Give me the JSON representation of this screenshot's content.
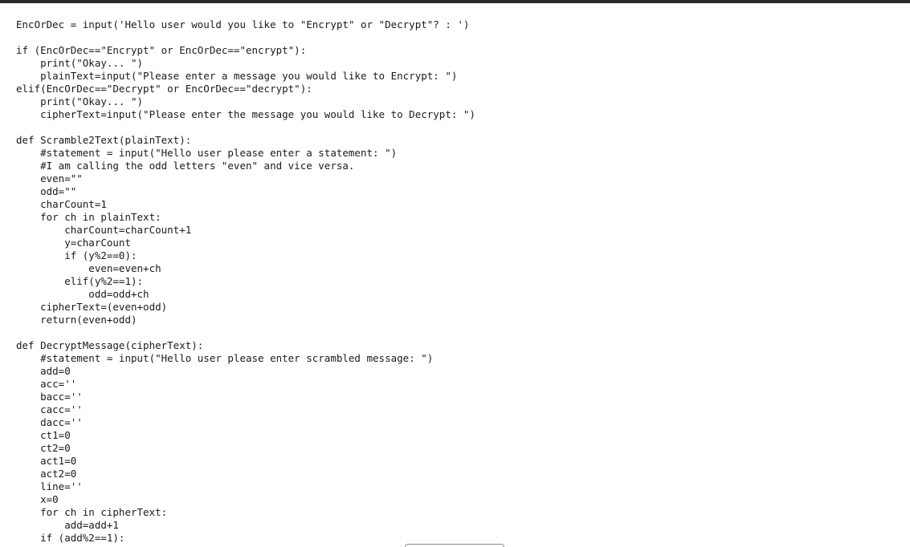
{
  "code": {
    "lines": [
      "EncOrDec = input('Hello user would you like to \"Encrypt\" or \"Decrypt\"? : ')",
      "",
      "if (EncOrDec==\"Encrypt\" or EncOrDec==\"encrypt\"):",
      "    print(\"Okay... \")",
      "    plainText=input(\"Please enter a message you would like to Encrypt: \")",
      "elif(EncOrDec==\"Decrypt\" or EncOrDec==\"decrypt\"):",
      "    print(\"Okay... \")",
      "    cipherText=input(\"Please enter the message you would like to Decrypt: \")",
      "",
      "def Scramble2Text(plainText):",
      "    #statement = input(\"Hello user please enter a statement: \")",
      "    #I am calling the odd letters \"even\" and vice versa.",
      "    even=\"\"",
      "    odd=\"\"",
      "    charCount=1",
      "    for ch in plainText:",
      "        charCount=charCount+1",
      "        y=charCount",
      "        if (y%2==0):",
      "            even=even+ch",
      "        elif(y%2==1):",
      "            odd=odd+ch",
      "    cipherText=(even+odd)",
      "    return(even+odd)",
      "",
      "def DecryptMessage(cipherText):",
      "    #statement = input(\"Hello user please enter scrambled message: \")",
      "    add=0",
      "    acc=''",
      "    bacc=''",
      "    cacc=''",
      "    dacc=''",
      "    ct1=0",
      "    ct2=0",
      "    act1=0",
      "    act2=0",
      "    line=''",
      "    x=0",
      "    for ch in cipherText:",
      "        add=add+1",
      "    if (add%2==1):"
    ]
  }
}
